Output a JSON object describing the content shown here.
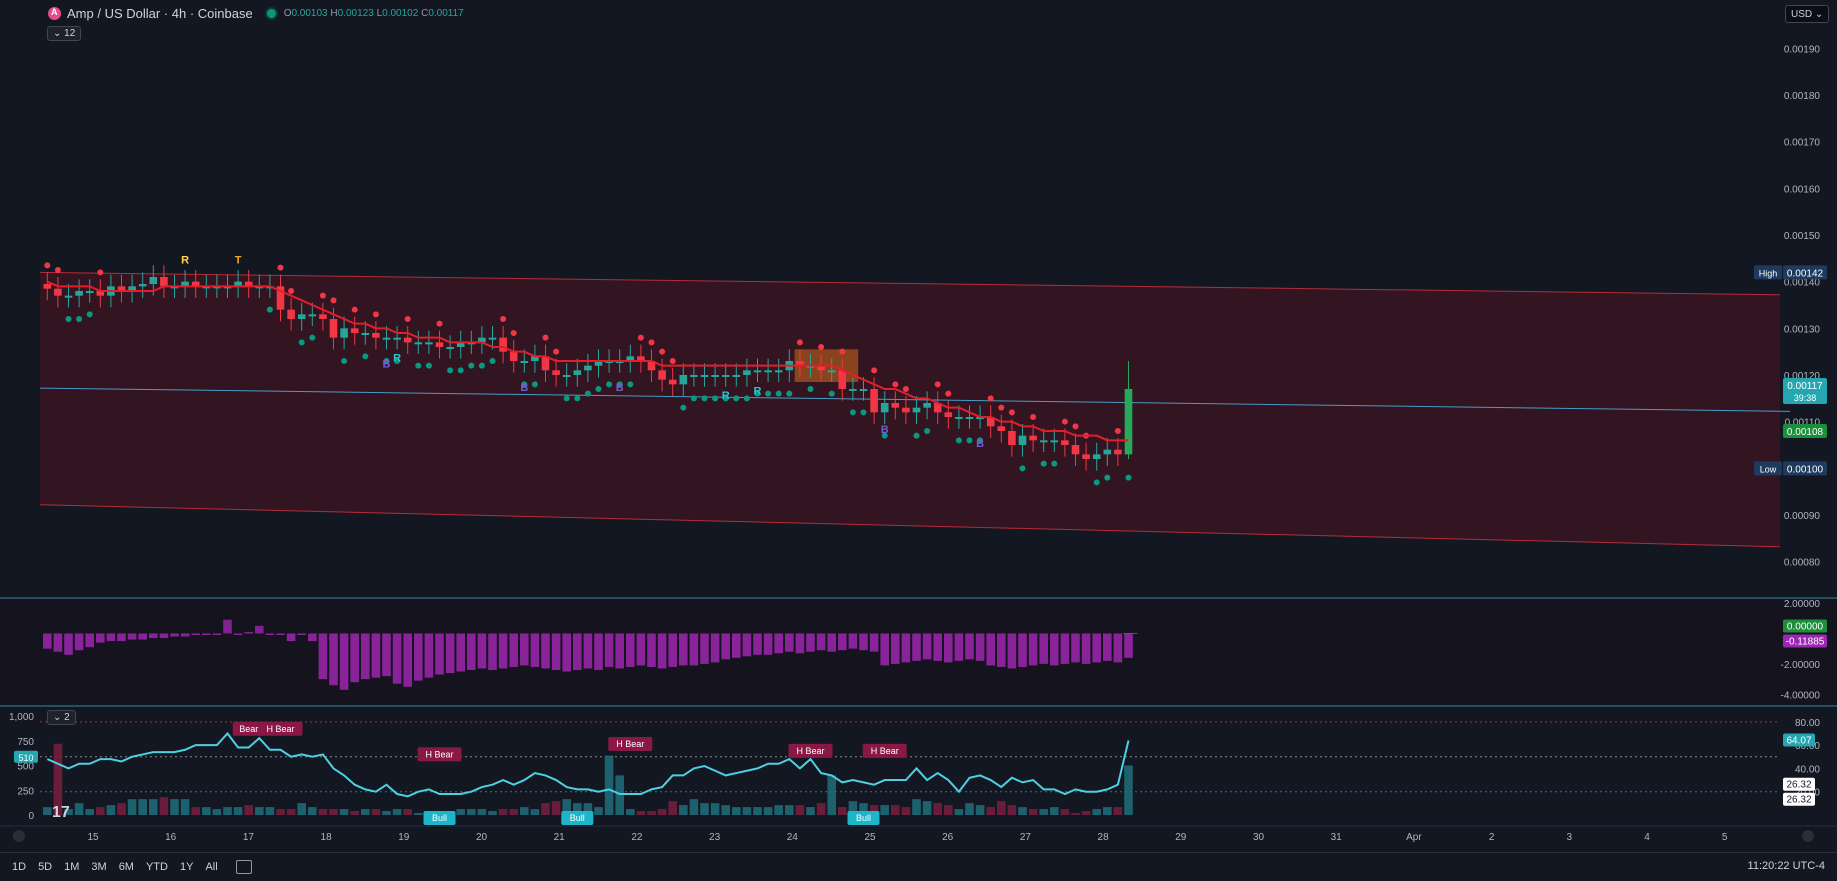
{
  "header": {
    "symbol": "Amp / US Dollar · 4h · Coinbase",
    "o_label": "O",
    "o_value": "0.00103",
    "h_label": "H",
    "h_value": "0.00123",
    "l_label": "L",
    "l_value": "0.00102",
    "c_label": "C",
    "c_value": "0.00117",
    "indicators_count": "12",
    "currency": "USD"
  },
  "colors": {
    "bg": "#131722",
    "up": "#26a69a",
    "down": "#f23645",
    "channel": "#f23645",
    "ma": "#e21e2b",
    "macd_hist": "#9c27b0",
    "rsi_line": "#4dd0e1"
  },
  "chart_data": [
    {
      "type": "candlestick",
      "title": "Amp / US Dollar · 4h · Coinbase",
      "ylim": [
        0.00075,
        0.00195
      ],
      "yticks": [
        "0.00190",
        "0.00180",
        "0.00170",
        "0.00160",
        "0.00150",
        "0.00140",
        "0.00130",
        "0.00120",
        "0.00110",
        "0.00100",
        "0.00090",
        "0.00080"
      ],
      "xticks": [
        "15",
        "16",
        "17",
        "18",
        "19",
        "20",
        "21",
        "22",
        "23",
        "24",
        "25",
        "26",
        "27",
        "28",
        "29",
        "30",
        "31",
        "Apr",
        "2",
        "3",
        "4",
        "5"
      ],
      "close": [
        0.001385,
        0.00137,
        0.00137,
        0.00138,
        0.00138,
        0.00137,
        0.00139,
        0.00138,
        0.00139,
        0.001395,
        0.00141,
        0.00139,
        0.00139,
        0.0014,
        0.00139,
        0.00139,
        0.00139,
        0.00139,
        0.0014,
        0.00139,
        0.00139,
        0.00139,
        0.00134,
        0.00132,
        0.00133,
        0.00133,
        0.00132,
        0.00128,
        0.0013,
        0.00129,
        0.00129,
        0.00128,
        0.00128,
        0.00128,
        0.00127,
        0.00127,
        0.00127,
        0.00126,
        0.00126,
        0.00127,
        0.00127,
        0.00128,
        0.00128,
        0.00125,
        0.00123,
        0.00123,
        0.00124,
        0.00121,
        0.0012,
        0.0012,
        0.00121,
        0.00122,
        0.00123,
        0.00123,
        0.00123,
        0.00124,
        0.00123,
        0.00121,
        0.00119,
        0.00118,
        0.0012,
        0.0012,
        0.0012,
        0.0012,
        0.0012,
        0.0012,
        0.00121,
        0.00121,
        0.00121,
        0.00121,
        0.00123,
        0.00122,
        0.00122,
        0.00121,
        0.00121,
        0.00117,
        0.00117,
        0.00117,
        0.00112,
        0.00114,
        0.00113,
        0.00112,
        0.00113,
        0.00114,
        0.00112,
        0.00111,
        0.00111,
        0.00111,
        0.00111,
        0.00109,
        0.00108,
        0.00105,
        0.00107,
        0.00106,
        0.00106,
        0.00106,
        0.00105,
        0.00103,
        0.00102,
        0.00103,
        0.00104,
        0.00103,
        0.00117
      ],
      "ma": [
        0.0014,
        0.00139,
        0.00139,
        0.00139,
        0.00139,
        0.00138,
        0.00138,
        0.00138,
        0.00138,
        0.00138,
        0.00138,
        0.00139,
        0.00139,
        0.00139,
        0.00139,
        0.00139,
        0.00139,
        0.00139,
        0.00139,
        0.00139,
        0.00139,
        0.00139,
        0.00138,
        0.00137,
        0.00136,
        0.00135,
        0.00134,
        0.00133,
        0.00132,
        0.00131,
        0.00131,
        0.0013,
        0.0013,
        0.00129,
        0.00129,
        0.00128,
        0.00128,
        0.00128,
        0.00127,
        0.00127,
        0.00127,
        0.00127,
        0.00126,
        0.00126,
        0.00125,
        0.00125,
        0.00124,
        0.00124,
        0.00123,
        0.00123,
        0.00123,
        0.00123,
        0.00123,
        0.00123,
        0.00123,
        0.00123,
        0.00123,
        0.00123,
        0.00122,
        0.00122,
        0.00122,
        0.00122,
        0.00122,
        0.00122,
        0.00122,
        0.00122,
        0.00122,
        0.00122,
        0.00122,
        0.00122,
        0.00122,
        0.00122,
        0.00122,
        0.00122,
        0.00122,
        0.00121,
        0.0012,
        0.00119,
        0.00118,
        0.00117,
        0.00117,
        0.00116,
        0.00115,
        0.00115,
        0.00114,
        0.00113,
        0.00113,
        0.00112,
        0.00111,
        0.00111,
        0.0011,
        0.0011,
        0.00109,
        0.00109,
        0.00108,
        0.00108,
        0.00108,
        0.00107,
        0.00107,
        0.00107,
        0.00106,
        0.00106,
        0.00106
      ],
      "channel_top": [
        0.00142,
        0.001372
      ],
      "channel_mid": [
        0.001172,
        0.001122
      ],
      "channel_bottom": [
        0.000922,
        0.000832
      ],
      "signals": [
        {
          "label": "R",
          "bar": 13,
          "pos": "above"
        },
        {
          "label": "T",
          "bar": 18,
          "pos": "above"
        },
        {
          "label": "R",
          "bar": 33,
          "pos": "below"
        },
        {
          "label": "B",
          "bar": 32,
          "pos": "below"
        },
        {
          "label": "B",
          "bar": 45,
          "pos": "below"
        },
        {
          "label": "B",
          "bar": 54,
          "pos": "below"
        },
        {
          "label": "R",
          "bar": 64,
          "pos": "below"
        },
        {
          "label": "R",
          "bar": 67,
          "pos": "below"
        },
        {
          "label": "B",
          "bar": 79,
          "pos": "below"
        },
        {
          "label": "B",
          "bar": 88,
          "pos": "below"
        }
      ],
      "price_labels": {
        "high_label": "High",
        "high_value": "0.00142",
        "last_value": "0.00117",
        "countdown": "39:38",
        "ma_value": "0.00108",
        "low_label": "Low",
        "low_value": "0.00100"
      }
    },
    {
      "type": "bar",
      "title": "",
      "ylim": [
        -4.5,
        2.0
      ],
      "yticks": [
        "2.00000",
        "-2.00000",
        "-4.00000"
      ],
      "values": [
        -1.0,
        -1.2,
        -1.4,
        -1.1,
        -0.9,
        -0.6,
        -0.5,
        -0.5,
        -0.4,
        -0.4,
        -0.3,
        -0.3,
        -0.2,
        -0.2,
        -0.1,
        -0.1,
        -0.1,
        0.9,
        -0.1,
        0.1,
        0.5,
        -0.1,
        -0.1,
        -0.5,
        -0.1,
        -0.5,
        -3.0,
        -3.4,
        -3.7,
        -3.2,
        -3.0,
        -2.9,
        -2.8,
        -3.3,
        -3.5,
        -3.1,
        -2.9,
        -2.7,
        -2.6,
        -2.5,
        -2.4,
        -2.3,
        -2.4,
        -2.3,
        -2.2,
        -2.1,
        -2.2,
        -2.3,
        -2.4,
        -2.5,
        -2.4,
        -2.3,
        -2.4,
        -2.2,
        -2.3,
        -2.2,
        -2.1,
        -2.2,
        -2.3,
        -2.2,
        -2.1,
        -2.1,
        -2.0,
        -1.9,
        -1.7,
        -1.6,
        -1.5,
        -1.4,
        -1.4,
        -1.3,
        -1.2,
        -1.3,
        -1.2,
        -1.1,
        -1.2,
        -1.1,
        -1.0,
        -1.1,
        -1.2,
        -2.1,
        -2.0,
        -1.9,
        -1.8,
        -1.7,
        -1.8,
        -1.9,
        -1.8,
        -1.7,
        -1.8,
        -2.1,
        -2.2,
        -2.3,
        -2.2,
        -2.1,
        -2.0,
        -2.1,
        -2.0,
        -1.9,
        -2.0,
        -1.9,
        -1.8,
        -1.9,
        -1.6
      ],
      "value_labels": {
        "v1": "0.00000",
        "v2": "-0.11885"
      }
    },
    {
      "type": "line",
      "title": "",
      "ylim": [
        0,
        1000
      ],
      "yticks_left": [
        "1,000",
        "750",
        "500",
        "250",
        "0"
      ],
      "yticks_right": [
        "80.00",
        "60.00",
        "40.00",
        "20.00"
      ],
      "line_label": "510",
      "indicators_count": "2",
      "rsi": [
        48,
        44,
        40,
        44,
        44,
        48,
        48,
        46,
        50,
        52,
        54,
        54,
        54,
        56,
        60,
        60,
        60,
        70,
        58,
        58,
        66,
        56,
        56,
        50,
        52,
        50,
        52,
        40,
        34,
        26,
        22,
        20,
        26,
        18,
        16,
        20,
        22,
        18,
        18,
        18,
        20,
        24,
        26,
        30,
        26,
        30,
        36,
        34,
        30,
        24,
        22,
        22,
        20,
        22,
        18,
        18,
        18,
        22,
        24,
        34,
        34,
        40,
        42,
        38,
        34,
        36,
        38,
        40,
        44,
        44,
        48,
        40,
        48,
        36,
        34,
        28,
        30,
        28,
        26,
        30,
        30,
        30,
        40,
        30,
        36,
        30,
        20,
        32,
        34,
        30,
        24,
        32,
        28,
        30,
        22,
        22,
        18,
        22,
        20,
        20,
        22,
        26,
        64
      ],
      "volume": [
        80,
        720,
        60,
        120,
        60,
        80,
        100,
        120,
        160,
        160,
        160,
        180,
        160,
        160,
        80,
        80,
        60,
        80,
        80,
        100,
        80,
        80,
        60,
        60,
        120,
        80,
        60,
        60,
        60,
        40,
        60,
        60,
        40,
        60,
        60,
        20,
        40,
        20,
        40,
        60,
        60,
        60,
        40,
        60,
        60,
        80,
        60,
        120,
        140,
        160,
        120,
        120,
        80,
        600,
        400,
        60,
        40,
        40,
        60,
        140,
        100,
        160,
        120,
        120,
        100,
        80,
        80,
        80,
        80,
        100,
        100,
        100,
        80,
        120,
        400,
        80,
        140,
        120,
        100,
        100,
        100,
        80,
        160,
        140,
        120,
        100,
        60,
        120,
        100,
        80,
        140,
        100,
        80,
        60,
        60,
        80,
        60,
        20,
        40,
        60,
        80,
        80,
        500
      ],
      "badges": [
        {
          "label": "Bear",
          "bar": 19,
          "y": 680
        },
        {
          "label": "H Bear",
          "bar": 22,
          "y": 680
        },
        {
          "label": "H Bear",
          "bar": 37,
          "y": 460
        },
        {
          "label": "Bull",
          "bar": 37,
          "y": 20
        },
        {
          "label": "Bull",
          "bar": 50,
          "y": 20
        },
        {
          "label": "H Bear",
          "bar": 55,
          "y": 550
        },
        {
          "label": "H Bear",
          "bar": 72,
          "y": 490
        },
        {
          "label": "H Bear",
          "bar": 79,
          "y": 490
        },
        {
          "label": "Bull",
          "bar": 77,
          "y": 40
        }
      ],
      "value_labels": {
        "v1": "64.07",
        "v2": "26.32",
        "v3": "26.32"
      }
    }
  ],
  "timeframes": [
    "1D",
    "5D",
    "1M",
    "3M",
    "6M",
    "YTD",
    "1Y",
    "All"
  ],
  "clock": "11:20:22 UTC-4"
}
